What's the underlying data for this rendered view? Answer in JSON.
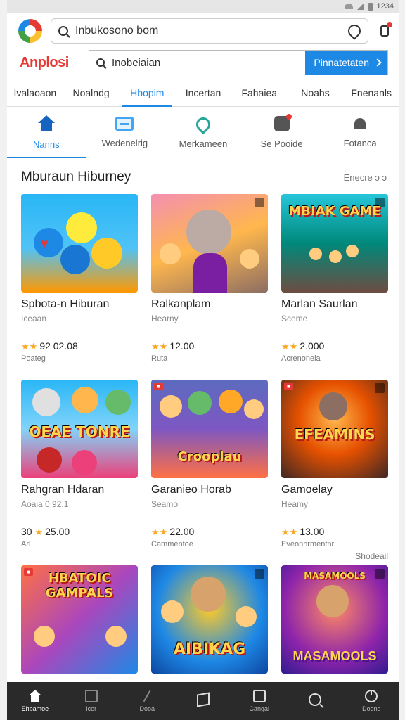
{
  "status": {
    "time": "1234"
  },
  "top_search": {
    "value": "Inbukosono bom"
  },
  "brand": {
    "name": "Anplosi"
  },
  "search": {
    "value": "Inobeiaian",
    "button_label": "Pinnatetaten"
  },
  "tabs": [
    {
      "label": "Ivalaoaon",
      "active": false
    },
    {
      "label": "Noalndg",
      "active": false
    },
    {
      "label": "Hbopim",
      "active": true
    },
    {
      "label": "Incertan",
      "active": false
    },
    {
      "label": "Fahaiea",
      "active": false
    },
    {
      "label": "Noahs",
      "active": false
    },
    {
      "label": "Fnenanls",
      "active": false
    }
  ],
  "categories": [
    {
      "label": "Nanns",
      "icon": "home-icon",
      "active": true
    },
    {
      "label": "Wedenelrig",
      "icon": "monitor-icon",
      "active": false
    },
    {
      "label": "Merkameen",
      "icon": "location-icon",
      "active": false
    },
    {
      "label": "Se Pooide",
      "icon": "notification-badge-icon",
      "active": false
    },
    {
      "label": "Fotanca",
      "icon": "bell-icon",
      "active": false
    }
  ],
  "section": {
    "title": "Mburaun Hiburney",
    "see_all": "Enecre ɔ ɔ"
  },
  "cards": [
    {
      "title": "Spbota-n Hiburan",
      "subtitle": "Iceaan",
      "rating": "92 02.08",
      "stars": "★★",
      "meta": "Poateg",
      "art_text": ""
    },
    {
      "title": "Ralkanplam",
      "subtitle": "Hearny",
      "rating": "12.00",
      "stars": "★★",
      "meta": "Ruta",
      "art_text": ""
    },
    {
      "title": "Marlan Saurlan",
      "subtitle": "Sceme",
      "rating": "2.000",
      "stars": "★★",
      "meta": "Acrenonela",
      "art_text": "MBIAK GAME"
    },
    {
      "title": "Rahgran Hdaran",
      "subtitle": "Aoaia 0:92.1",
      "rating": "25.00",
      "stars": "★",
      "meta": "Arl",
      "art_text": "OEAE TONRE",
      "prefix": "30"
    },
    {
      "title": "Garanieo Horab",
      "subtitle": "Seamo",
      "rating": "22.00",
      "stars": "★★",
      "meta": "Cammentoe",
      "art_text": "Crooplau"
    },
    {
      "title": "Gamoelay",
      "subtitle": "Heamy",
      "rating": "13.00",
      "stars": "★★",
      "meta": "Eveonnrmentnr",
      "art_text": "EFEAMINS",
      "extra": "Shodeail"
    },
    {
      "title": "",
      "subtitle": "",
      "rating": "",
      "stars": "",
      "meta": "",
      "art_text": "HBATOIC GAMPALS"
    },
    {
      "title": "",
      "subtitle": "",
      "rating": "",
      "stars": "",
      "meta": "",
      "art_text": "AIBIKAG"
    },
    {
      "title": "",
      "subtitle": "",
      "rating": "",
      "stars": "",
      "meta": "",
      "art_text": "MASAMOOLS"
    }
  ],
  "bottom_nav": [
    {
      "label": "Ehbamoe",
      "icon": "home-icon",
      "active": true
    },
    {
      "label": "Icer",
      "icon": "document-icon",
      "active": false
    },
    {
      "label": "Dooa",
      "icon": "slash-icon",
      "active": false
    },
    {
      "label": "",
      "icon": "cube-icon",
      "active": false
    },
    {
      "label": "Cangai",
      "icon": "box-icon",
      "active": false
    },
    {
      "label": "",
      "icon": "search-icon",
      "active": false
    },
    {
      "label": "Doons",
      "icon": "power-icon",
      "active": false
    }
  ],
  "colors": {
    "accent": "#1e88e5",
    "brand": "#e53935",
    "nav_bg": "#2a2a2a",
    "star": "#f9a825"
  }
}
